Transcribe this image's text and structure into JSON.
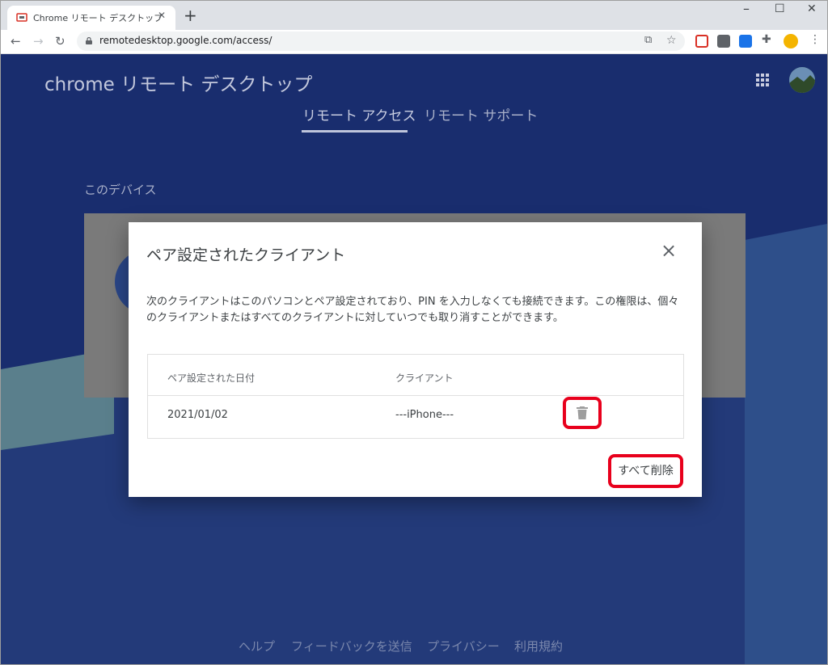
{
  "browser": {
    "tab_title": "Chrome リモート デスクトップ",
    "url": "remotedesktop.google.com/access/"
  },
  "app": {
    "brand": "chrome リモート デスクトップ",
    "tabs": [
      {
        "label": "リモート アクセス",
        "active": true
      },
      {
        "label": "リモート サポート",
        "active": false
      }
    ],
    "section_title": "このデバイス",
    "footer_links": [
      "ヘルプ",
      "フィードバックを送信",
      "プライバシー",
      "利用規約"
    ]
  },
  "dialog": {
    "title": "ペア設定されたクライアント",
    "description": "次のクライアントはこのパソコンとペア設定されており、PIN を入力しなくても接続できます。この権限は、個々のクライアントまたはすべてのクライアントに対していつでも取り消すことができます。",
    "columns": [
      "ペア設定された日付",
      "クライアント"
    ],
    "rows": [
      {
        "date": "2021/01/02",
        "client": "---iPhone---"
      }
    ],
    "delete_all_label": "すべて削除"
  },
  "colors": {
    "page_bg": "#233a79",
    "highlight": "#e8001c"
  }
}
